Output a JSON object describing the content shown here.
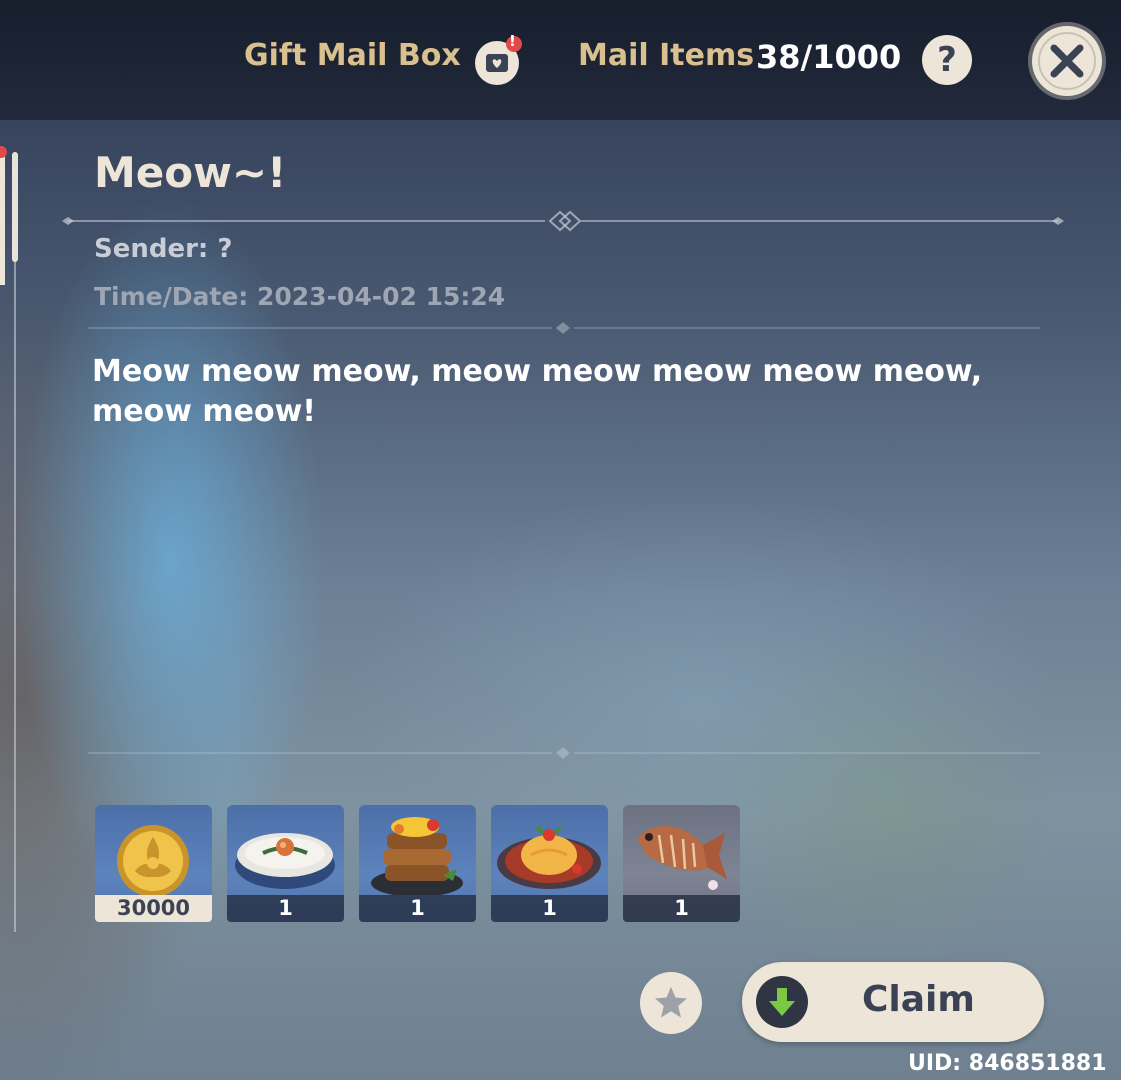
{
  "header": {
    "title": "Gift Mail Box",
    "mailbox_badge": "!",
    "items_label": "Mail Items",
    "items_count": "38/1000",
    "help_label": "?"
  },
  "mail": {
    "title": "Meow~!",
    "sender": "Sender: ?",
    "time_date": "Time/Date: 2023-04-02 15:24",
    "body": "Meow meow meow, meow meow meow meow meow, meow meow!"
  },
  "attachments": [
    {
      "name": "mora-icon",
      "count": "30000"
    },
    {
      "name": "rice-bowl-dish-icon",
      "count": "1"
    },
    {
      "name": "stacked-pancake-dish-icon",
      "count": "1"
    },
    {
      "name": "omurice-dish-icon",
      "count": "1"
    },
    {
      "name": "fish-icon",
      "count": "1"
    }
  ],
  "actions": {
    "claim_label": "Claim"
  },
  "footer": {
    "uid": "UID: 846851881"
  },
  "colors": {
    "gold_text": "#d9c08e",
    "button_bg": "#ece5d8",
    "badge_red": "#e24a4a",
    "claim_icon_green": "#7ac943"
  }
}
